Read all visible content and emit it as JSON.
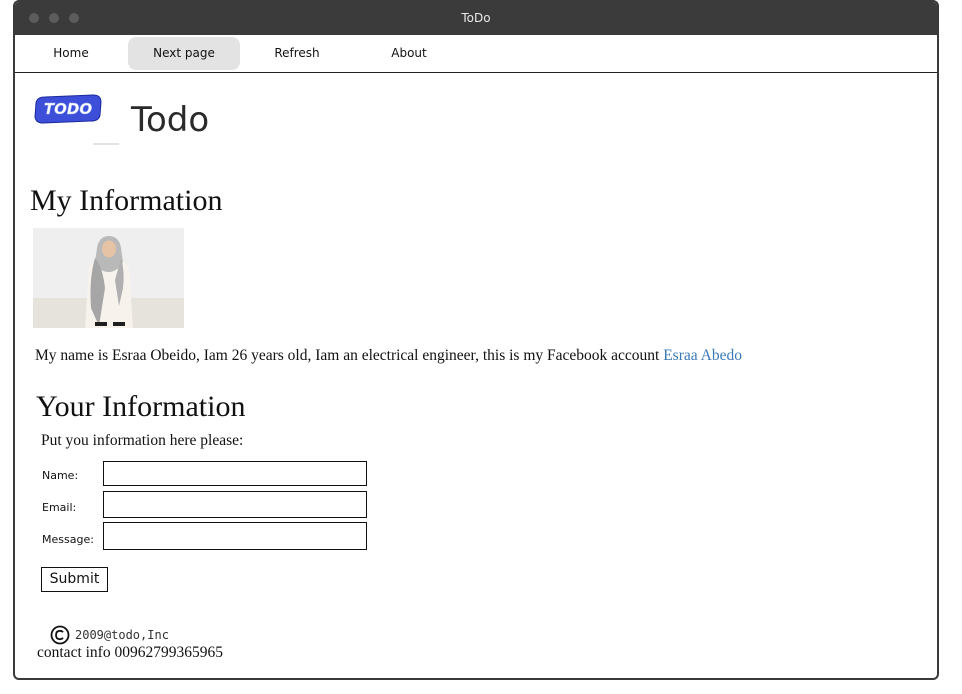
{
  "window": {
    "title": "ToDo"
  },
  "nav": {
    "items": [
      {
        "label": "Home"
      },
      {
        "label": "Next page"
      },
      {
        "label": "Refresh"
      },
      {
        "label": "About"
      }
    ]
  },
  "brand": {
    "logo_text": "TODO",
    "title": "Todo"
  },
  "my_info": {
    "heading": "My Information",
    "bio_text": "My name is Esraa Obeido, Iam 26 years old, Iam an electrical engineer, this is my Facebook account ",
    "link_text": "Esraa Abedo"
  },
  "your_info": {
    "heading": "Your Information",
    "instruction": "Put you information here please:",
    "fields": {
      "name_label": "Name:",
      "email_label": "Email:",
      "message_label": "Message:"
    },
    "submit_label": "Submit"
  },
  "footer": {
    "copyright_symbol": "©",
    "copyright_text": "2009@todo,Inc",
    "contact": "contact info 00962799365965"
  },
  "colors": {
    "titlebar": "#3b3b3b",
    "nav_active": "#e3e3e3",
    "link": "#3a7ab8",
    "logo_blue": "#3d4fd9"
  }
}
